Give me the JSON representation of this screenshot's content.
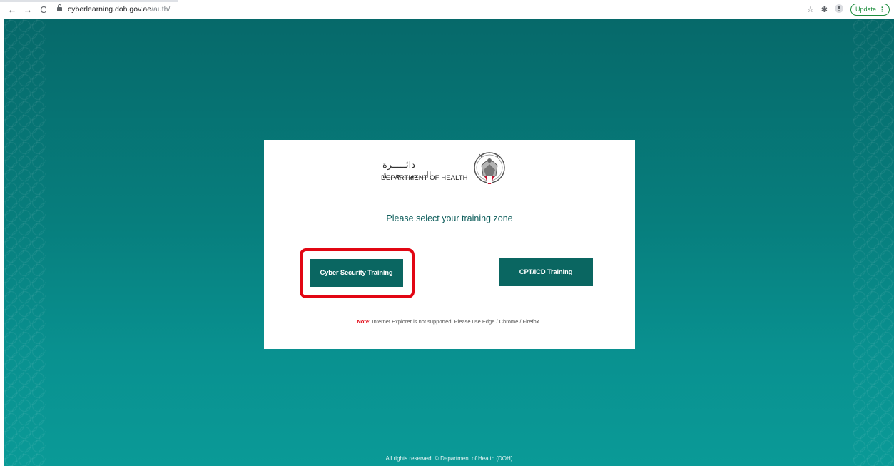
{
  "browser": {
    "url_host": "cyberlearning.doh.gov.ae",
    "url_path": "/auth/",
    "back_icon": "←",
    "forward_icon": "→",
    "reload_icon": "C",
    "star_icon": "☆",
    "extensions_icon": "✱",
    "profile_icon": "👤",
    "update_label": "Update",
    "menu_dots": "⋮"
  },
  "logo": {
    "arabic_name": "دائـــــرة الـــصـــحـــة",
    "english_name": "DEPARTMENT OF HEALTH"
  },
  "page": {
    "heading": "Please select your training zone",
    "cyber_button": "Cyber Security Training",
    "cpt_button": "CPT/ICD Training",
    "note_label": "Note:",
    "note_text": " Internet Explorer is not supported. Please use Edge / Chrome / Firefox .",
    "footer": "All rights reserved. © Department of Health (DOH)"
  },
  "colors": {
    "brand_teal": "#0a6661",
    "highlight_red": "#e20613",
    "background_top": "#06696a",
    "background_bottom": "#0a9a97"
  }
}
